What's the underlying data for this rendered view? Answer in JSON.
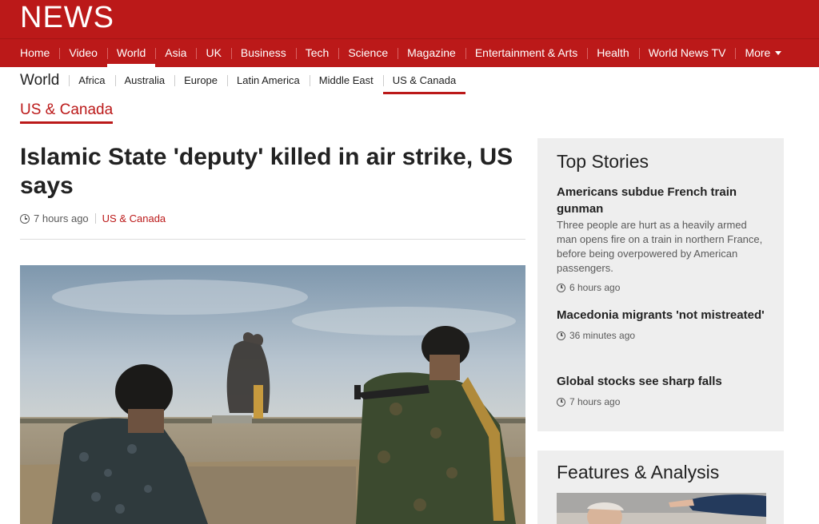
{
  "brand": {
    "logo": "NEWS",
    "color": "#bb1919"
  },
  "main_nav": {
    "items": [
      "Home",
      "Video",
      "World",
      "Asia",
      "UK",
      "Business",
      "Tech",
      "Science",
      "Magazine",
      "Entertainment & Arts",
      "Health",
      "World News TV",
      "More"
    ],
    "active": "World"
  },
  "sub_nav": {
    "title": "World",
    "items": [
      "Africa",
      "Australia",
      "Europe",
      "Latin America",
      "Middle East",
      "US & Canada"
    ],
    "active": "US & Canada"
  },
  "section": {
    "title": "US & Canada"
  },
  "article": {
    "headline": "Islamic State 'deputy' killed in air strike, US says",
    "time": "7 hours ago",
    "section_link": "US & Canada",
    "image_icon": "photo-soldiers-watching-explosion"
  },
  "top_stories": {
    "title": "Top Stories",
    "stories": [
      {
        "title": "Americans subdue French train gunman",
        "summary": "Three people are hurt as a heavily armed man opens fire on a train in northern France, before being overpowered by American passengers.",
        "time": "6 hours ago"
      },
      {
        "title": "Macedonia migrants 'not mistreated'",
        "summary": "",
        "time": "36 minutes ago"
      },
      {
        "title": "Global stocks see sharp falls",
        "summary": "",
        "time": "7 hours ago"
      }
    ]
  },
  "features": {
    "title": "Features & Analysis"
  }
}
